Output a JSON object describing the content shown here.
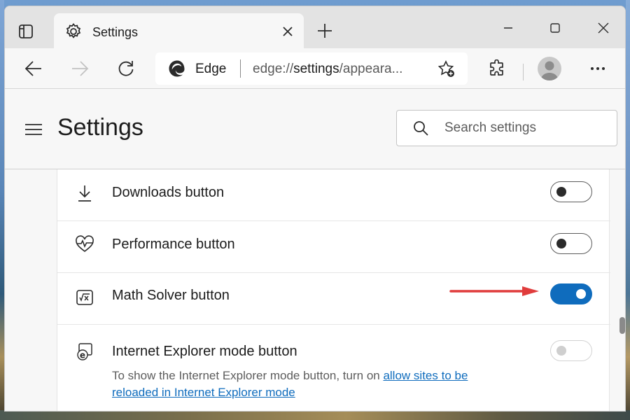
{
  "tab": {
    "title": "Settings"
  },
  "address": {
    "site": "Edge",
    "url_scheme": "edge://",
    "url_host": "settings",
    "url_path": "/appeara..."
  },
  "page": {
    "title": "Settings",
    "search_placeholder": "Search settings"
  },
  "rows": [
    {
      "label": "Downloads button",
      "toggle": "off"
    },
    {
      "label": "Performance button",
      "toggle": "off"
    },
    {
      "label": "Math Solver button",
      "toggle": "on"
    },
    {
      "label": "Internet Explorer mode button",
      "toggle": "disabled",
      "desc_prefix": "To show the Internet Explorer mode button, turn on ",
      "desc_link_1": "allow sites to be",
      "desc_link_2": "reloaded in Internet Explorer mode"
    }
  ],
  "colors": {
    "accent": "#0f6cbd",
    "annotation_arrow": "#e03c3c"
  }
}
